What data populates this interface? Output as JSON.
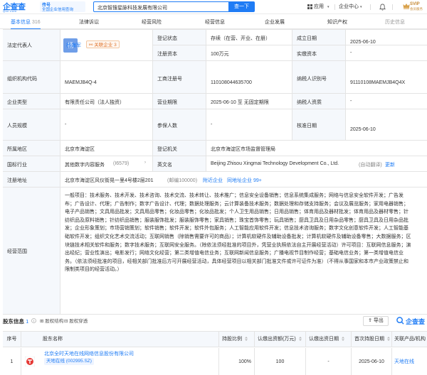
{
  "header": {
    "logo_text": "企查查",
    "logo_sub": "Qcc.com",
    "tag_line1": "传号",
    "tag_line2": "全国企业信用查询",
    "search_value": "北京智搜星脉科技发展有限公司",
    "search_button": "查一下",
    "apps_label": "应用",
    "enterprise_center": "企业中心",
    "svip_label": "SVIP",
    "svip_sub": "会员服务"
  },
  "tabs": [
    {
      "label": "基本信息",
      "count": "316",
      "active": true
    },
    {
      "label": "法律诉讼"
    },
    {
      "label": "经营风险"
    },
    {
      "label": "经营信息"
    },
    {
      "label": "企业发展"
    },
    {
      "label": "知识产权"
    },
    {
      "label": "历史信息"
    }
  ],
  "basic": {
    "legal_rep_label": "法定代表人",
    "legal_rep_avatar": "杨",
    "legal_rep_name": "杨海军",
    "related_label": "关联企业",
    "related_count": "3",
    "reg_status_label": "登记状态",
    "reg_status_value": "存续（在营、开业、在册）",
    "est_date_label": "成立日期",
    "est_date_value": "2025-06-10",
    "reg_capital_label": "注册资本",
    "reg_capital_value": "100万元",
    "paid_capital_label": "实缴资本",
    "paid_capital_value": "-",
    "org_code_label": "组织机构代码",
    "org_code_value": "MAEMJB4Q-4",
    "biz_reg_no_label": "工商注册号",
    "biz_reg_no_value": "110108044635700",
    "tax_id_label": "纳税人识别号",
    "tax_id_value": "91110108MAEMJB4Q4X",
    "company_type_label": "企业类型",
    "company_type_value": "有限责任公司（法人独资）",
    "biz_term_label": "营业期限",
    "biz_term_value": "2025-06-10 至 无固定期限",
    "taxpayer_qual_label": "纳税人资质",
    "taxpayer_qual_value": "-",
    "staff_size_label": "人员规模",
    "staff_size_value": "-",
    "insured_label": "参保人数",
    "insured_value": "-",
    "approval_date_label": "核准日期",
    "approval_date_value": "2025-06-10",
    "region_label": "所属地区",
    "region_value": "北京市海淀区",
    "authority_label": "登记机关",
    "authority_value": "北京市海淀区市场监督管理局",
    "industry_label": "国标行业",
    "industry_value": "其他数字内容服务",
    "industry_code": "(I6579)",
    "en_name_label": "英文名",
    "en_name_value": "Beijing Zhisou Xingmai Technology Development Co., Ltd.",
    "en_name_note": "(自动翻译)",
    "en_name_update": "更新",
    "address_label": "注册地址",
    "address_value": "北京市海淀区风仪街晃一里4号楼2层201",
    "postcode": "(邮编100000)",
    "nearby_label": "附近企业",
    "same_address_label": "同地址企业",
    "same_address_count": "99+",
    "scope_label": "经营范围",
    "scope_value": "一般项目：技术服务、技术开发、技术咨询、技术交流、技术转让、技术推广；信息安全设备销售；信息系统集成服务；网络与信息安全软件开发；广告发布；广告设计、代理；广告制作；数字广告设计、代理；数据处理服务；云计算装备技术服务；数据处理和存储支持服务；会议及展览服务；家用电器销售；电子产品销售；文具用品批发；文具用品零售；化妆品零售；化妆品批发；个人卫生用品销售；日用品销售；体育用品及器材批发；体育用品及器材零售；针纺织品及原料销售；针纺织品销售；服装服饰批发；服装服饰零售；家具销售；珠宝首饰零售；玩具销售；厨具卫具及日用杂品零售；厨具卫具及日用杂品批发；企业形象策划；市场营销策划；软件销售；软件开发；软件外包服务；人工智能应用软件开发；信息技术咨询服务；数字文化创意软件开发；人工智能基础软件开发；组织文化艺术交流活动；互联网销售（除销售需要许可的商品）；计算机软硬件及辅助设备批发；计算机软硬件及辅助设备零售；大数据服务；区块链技术相关软件和服务；数字技术服务；互联网安全服务。（除依法须经批准的项目外，凭营业执照依法自主开展经营活动）许可项目：互联网信息服务；演出经纪；营业性演出；电影发行；网络文化经营；第二类增值电信业务；互联网新闻信息服务；广播电视节目制作经营；基础电信业务；第一类增值电信业务。（依法须经批准的项目，经相关部门批准后方可开展经营活动，具体经营项目以相关部门批准文件或许可证件为准）（不得从事国家和本市产业政策禁止和限制类项目的经营活动。）"
  },
  "shareholders": {
    "title": "股东信息",
    "count": "1",
    "btn_share_structure": "股权结构",
    "btn_equity_penetration": "股权穿透",
    "export_label": "导出",
    "watermark": "企查查",
    "columns": [
      "序号",
      "股东名称",
      "持股比例",
      "认缴出资额(万元)",
      "认缴出资日期",
      "首次持股日期",
      "关联产品/机构"
    ],
    "rows": [
      {
        "index": "1",
        "name": "北京全时天地在线网络信息股份有限公司",
        "stock_tag": "天地在线 (002995.SZ)",
        "ratio": "100%",
        "amount": "100",
        "sub_date": "-",
        "first_date": "2025-06-10",
        "product": "天地在线"
      }
    ]
  },
  "colors": {
    "accent": "#1f7cf5",
    "label_bg": "#f5f8fc",
    "border": "#e4e4e4",
    "orange": "#e0742c"
  }
}
